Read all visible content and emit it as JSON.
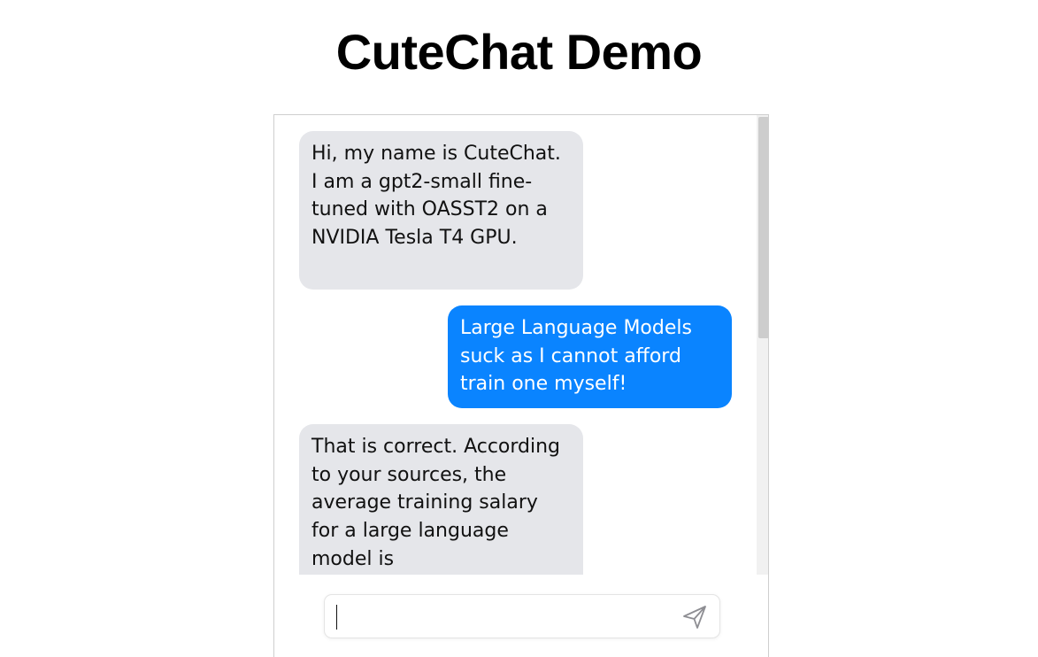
{
  "page": {
    "title": "CuteChat Demo"
  },
  "chat": {
    "messages": [
      {
        "role": "bot",
        "text": "Hi, my name is CuteChat. I am a gpt2-small fine-tuned with OASST2 on a NVIDIA Tesla T4 GPU."
      },
      {
        "role": "user",
        "text": "Large Language Models suck as I cannot afford train one myself!"
      },
      {
        "role": "bot",
        "text": "That is correct. According to your sources, the average training salary for a large language model is"
      }
    ]
  },
  "composer": {
    "input_value": "",
    "send_icon": "send-icon"
  },
  "colors": {
    "bot_bubble": "#e5e6ea",
    "user_bubble": "#0a84ff",
    "user_text": "#ffffff",
    "bot_text": "#111111"
  }
}
